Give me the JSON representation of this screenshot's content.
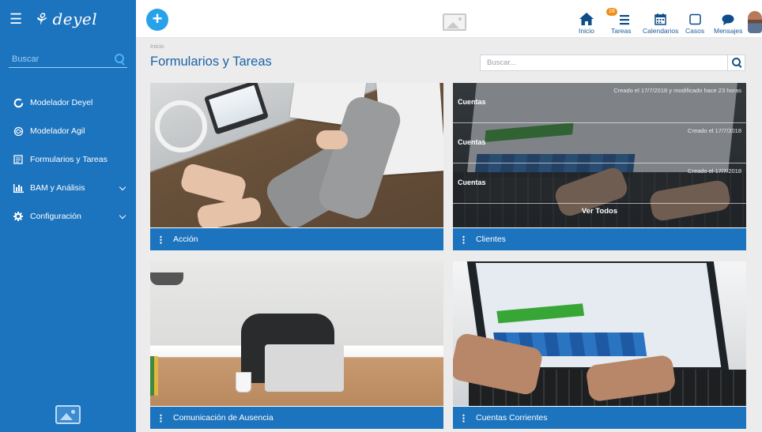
{
  "app": {
    "brand": "deyel"
  },
  "sidebar": {
    "search_placeholder": "Buscar",
    "items": [
      {
        "label": "Modelador Deyel",
        "icon": "circle-notch-icon"
      },
      {
        "label": "Modelador Agil",
        "icon": "gear-circle-icon"
      },
      {
        "label": "Formularios y Tareas",
        "icon": "form-icon"
      },
      {
        "label": "BAM y Análisis",
        "icon": "bar-chart-icon",
        "expandable": true
      },
      {
        "label": "Configuración",
        "icon": "gear-icon",
        "expandable": true
      }
    ]
  },
  "topbar": {
    "nav": [
      {
        "label": "Inicio",
        "icon": "home-icon"
      },
      {
        "label": "Tareas",
        "icon": "tasks-icon",
        "badge": "18"
      },
      {
        "label": "Calendarios",
        "icon": "calendar-icon"
      },
      {
        "label": "Casos",
        "icon": "case-icon"
      },
      {
        "label": "Mensajes",
        "icon": "chat-icon"
      }
    ]
  },
  "main": {
    "breadcrumb": "Inicio",
    "title": "Formularios y Tareas",
    "search_placeholder": "Buscar..."
  },
  "cards": [
    {
      "title": "Acción"
    },
    {
      "title": "Clientes",
      "rows": [
        {
          "label": "Cuentas",
          "meta": "Creado el 17/7/2018 y modificado hace 23 horas"
        },
        {
          "label": "Cuentas",
          "meta": "Creado el 17/7/2018"
        },
        {
          "label": "Cuentas",
          "meta": "Creado el 17/7/2018"
        }
      ],
      "view_all": "Ver Todos"
    },
    {
      "title": "Comunicación de Ausencia"
    },
    {
      "title": "Cuentas Corrientes"
    }
  ],
  "colors": {
    "primary": "#1c73be",
    "accent": "#27a1e9",
    "badge": "#ee8e16"
  }
}
